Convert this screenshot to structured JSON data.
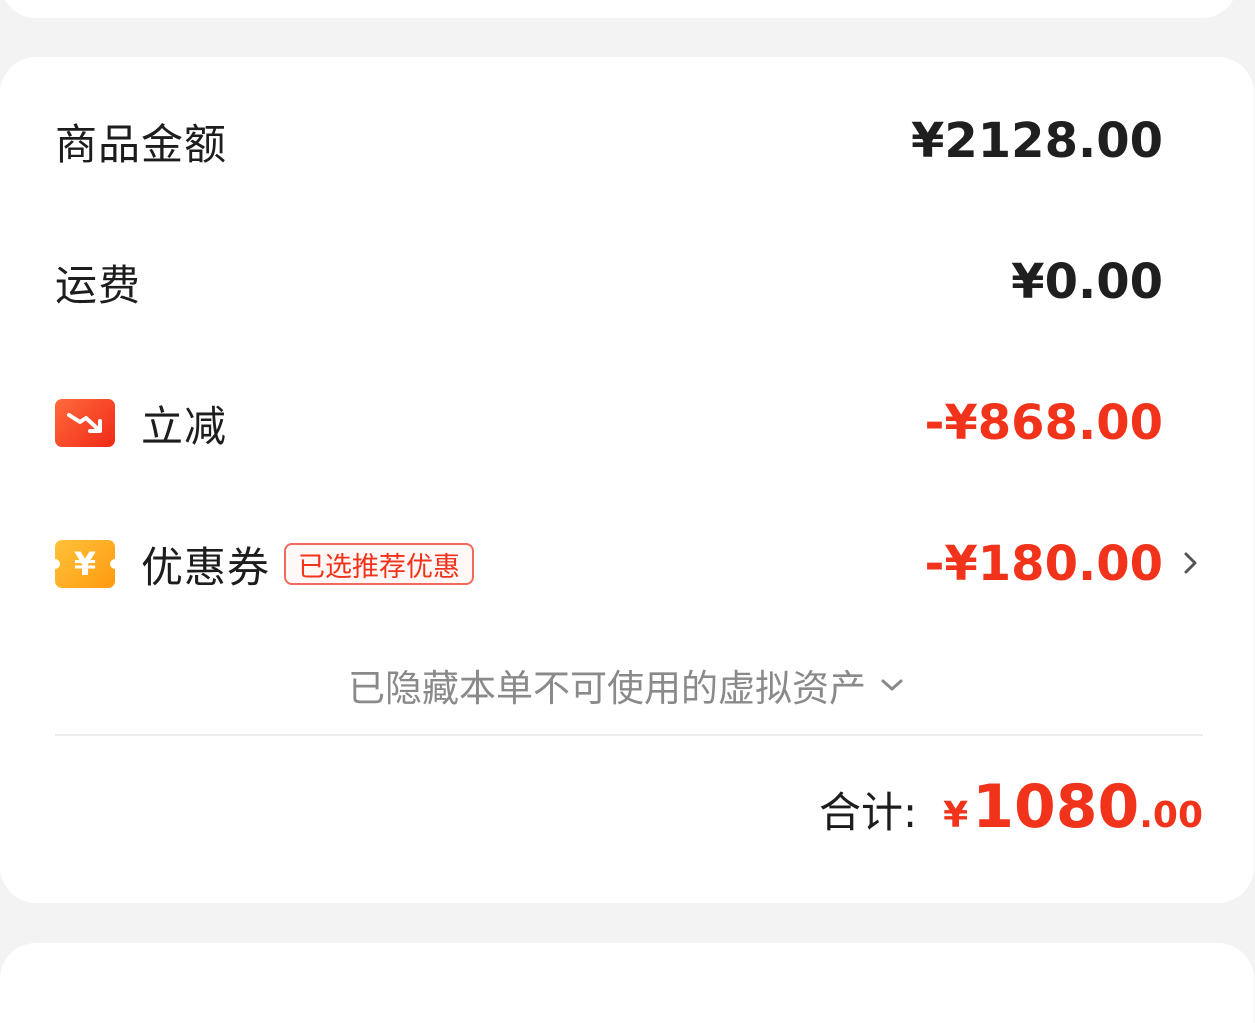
{
  "summary": {
    "goods_amount": {
      "label": "商品金额",
      "value": "¥2128.00"
    },
    "shipping": {
      "label": "运费",
      "value": "¥0.00"
    },
    "instant_discount": {
      "label": "立减",
      "value": "-¥868.00",
      "icon": "trend-down-icon"
    },
    "coupon": {
      "label": "优惠券",
      "tag": "已选推荐优惠",
      "value": "-¥180.00",
      "icon": "yen-coupon-icon"
    },
    "hidden_assets_note": "已隐藏本单不可使用的虚拟资产",
    "total": {
      "label": "合计:",
      "currency": "¥",
      "integer": "1080",
      "decimal": ".00"
    }
  },
  "colors": {
    "accent_red": "#f2331c",
    "coupon_orange": "#ffa41c",
    "background": "#f3f3f3",
    "card": "#ffffff"
  }
}
